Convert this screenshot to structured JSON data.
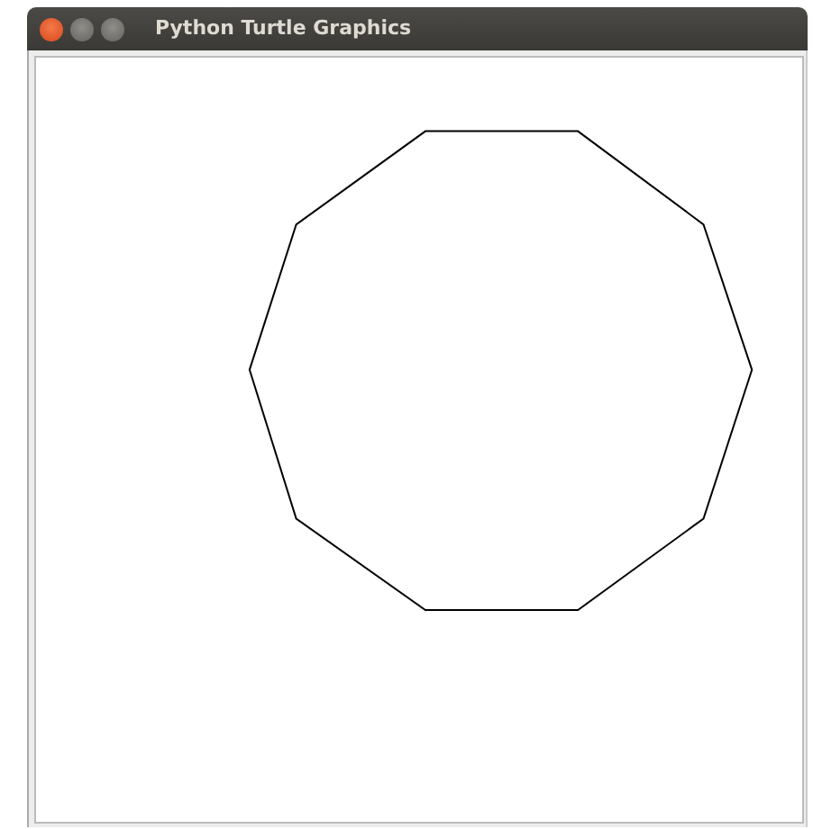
{
  "window": {
    "title": "Python Turtle Graphics"
  },
  "canvas": {
    "shapes": [
      {
        "kind": "decagon"
      }
    ]
  }
}
